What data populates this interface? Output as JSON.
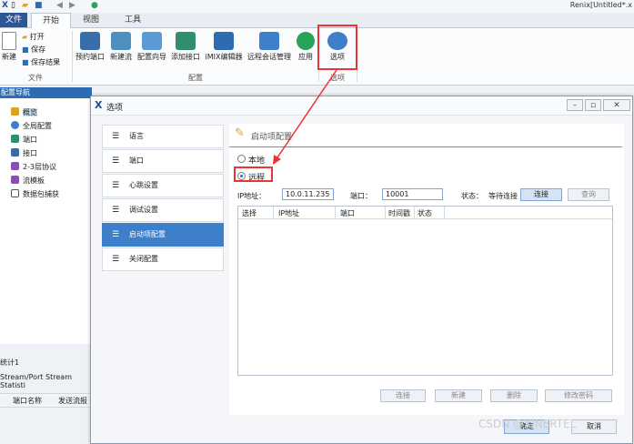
{
  "app": {
    "title": "Renix[Untitled*.x",
    "tabs": {
      "file": "文件",
      "start": "开始",
      "view": "视图",
      "tools": "工具"
    }
  },
  "ribbon": {
    "file_group": {
      "new": "新建",
      "open": "打开",
      "save": "保存",
      "save_result": "保存结果",
      "label": "文件"
    },
    "config_group": {
      "reserve_port": "预约端口",
      "new_stream": "新建流",
      "config_wizard": "配置向导",
      "add_interface": "添加接口",
      "imix_editor": "iMIX编辑器",
      "remote_session": "远程会话管理",
      "apply": "应用",
      "label": "配置"
    },
    "options_group": {
      "options": "选项",
      "label": "选项"
    }
  },
  "nav": {
    "header": "配置导航",
    "items": [
      "概览",
      "全局配置",
      "端口",
      "接口",
      "2-3层协议",
      "流模板",
      "数据包捕获"
    ]
  },
  "bottom": {
    "stats_tab": "统计1",
    "stats_row": "Stream/Port Stream Statisti",
    "col_port_name": "端口名称",
    "col_tx": "发送流报"
  },
  "dialog": {
    "title": "选项",
    "menu": [
      "语言",
      "端口",
      "心跳设置",
      "调试设置",
      "启动项配置",
      "关闭配置"
    ],
    "section_title": "启动项配置",
    "radio_local": "本地",
    "radio_remote": "远程",
    "ip_label": "IP地址：",
    "ip_value": "10.0.11.235",
    "port_label": "端口：",
    "port_value": "10001",
    "status_label": "状态：",
    "status_value": "等待连接",
    "btn_connect": "连接",
    "btn_query": "查询",
    "grid_columns": [
      "选择",
      "IP地址",
      "端口",
      "时间戳",
      "状态"
    ],
    "btn_connect2": "连接",
    "btn_new": "新建",
    "btn_delete": "删除",
    "btn_change_pwd": "修改密码",
    "btn_ok": "确定",
    "btn_cancel": "取消"
  },
  "watermark": "CSDN @XINERTEL",
  "colors": {
    "accent": "#2d6cb3",
    "highlight": "#e33333",
    "file_tab": "#2b5797"
  }
}
